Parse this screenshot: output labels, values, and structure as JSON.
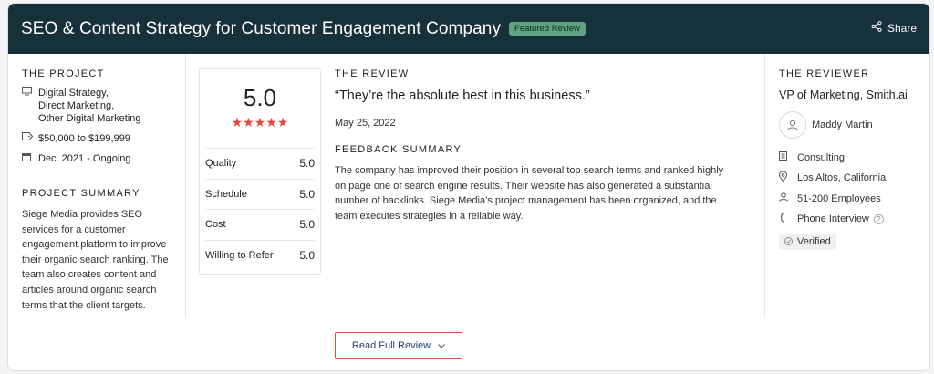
{
  "header": {
    "title": "SEO & Content Strategy for Customer Engagement Company",
    "badge": "Featured Review",
    "share_label": "Share"
  },
  "project": {
    "heading": "THE PROJECT",
    "services": [
      "Digital Strategy,",
      "Direct Marketing,",
      "Other Digital Marketing"
    ],
    "budget": "$50,000 to $199,999",
    "dates": "Dec. 2021 - Ongoing",
    "summary_heading": "PROJECT SUMMARY",
    "summary": "Siege Media provides SEO services for a customer engagement platform to improve their organic search ranking. The team also creates content and articles around organic search terms that the client targets."
  },
  "scores": {
    "overall": "5.0",
    "stars": 5,
    "rows": [
      {
        "label": "Quality",
        "value": "5.0"
      },
      {
        "label": "Schedule",
        "value": "5.0"
      },
      {
        "label": "Cost",
        "value": "5.0"
      },
      {
        "label": "Willing to Refer",
        "value": "5.0"
      }
    ]
  },
  "review": {
    "heading": "THE REVIEW",
    "quote": "“They’re the absolute best in this business.”",
    "date": "May 25, 2022",
    "feedback_heading": "FEEDBACK SUMMARY",
    "feedback": "The company has improved their position in several top search terms and ranked highly on page one of search engine results. Their website has also generated a substantial number of backlinks. Siege Media’s project management has been organized, and the team executes strategies in a reliable way."
  },
  "reviewer": {
    "heading": "THE REVIEWER",
    "title": "VP of Marketing, Smith.ai",
    "name": "Maddy Martin",
    "industry": "Consulting",
    "location": "Los Altos, California",
    "size": "51-200 Employees",
    "method": "Phone Interview",
    "verified": "Verified"
  },
  "footer": {
    "read_full_label": "Read Full Review"
  }
}
